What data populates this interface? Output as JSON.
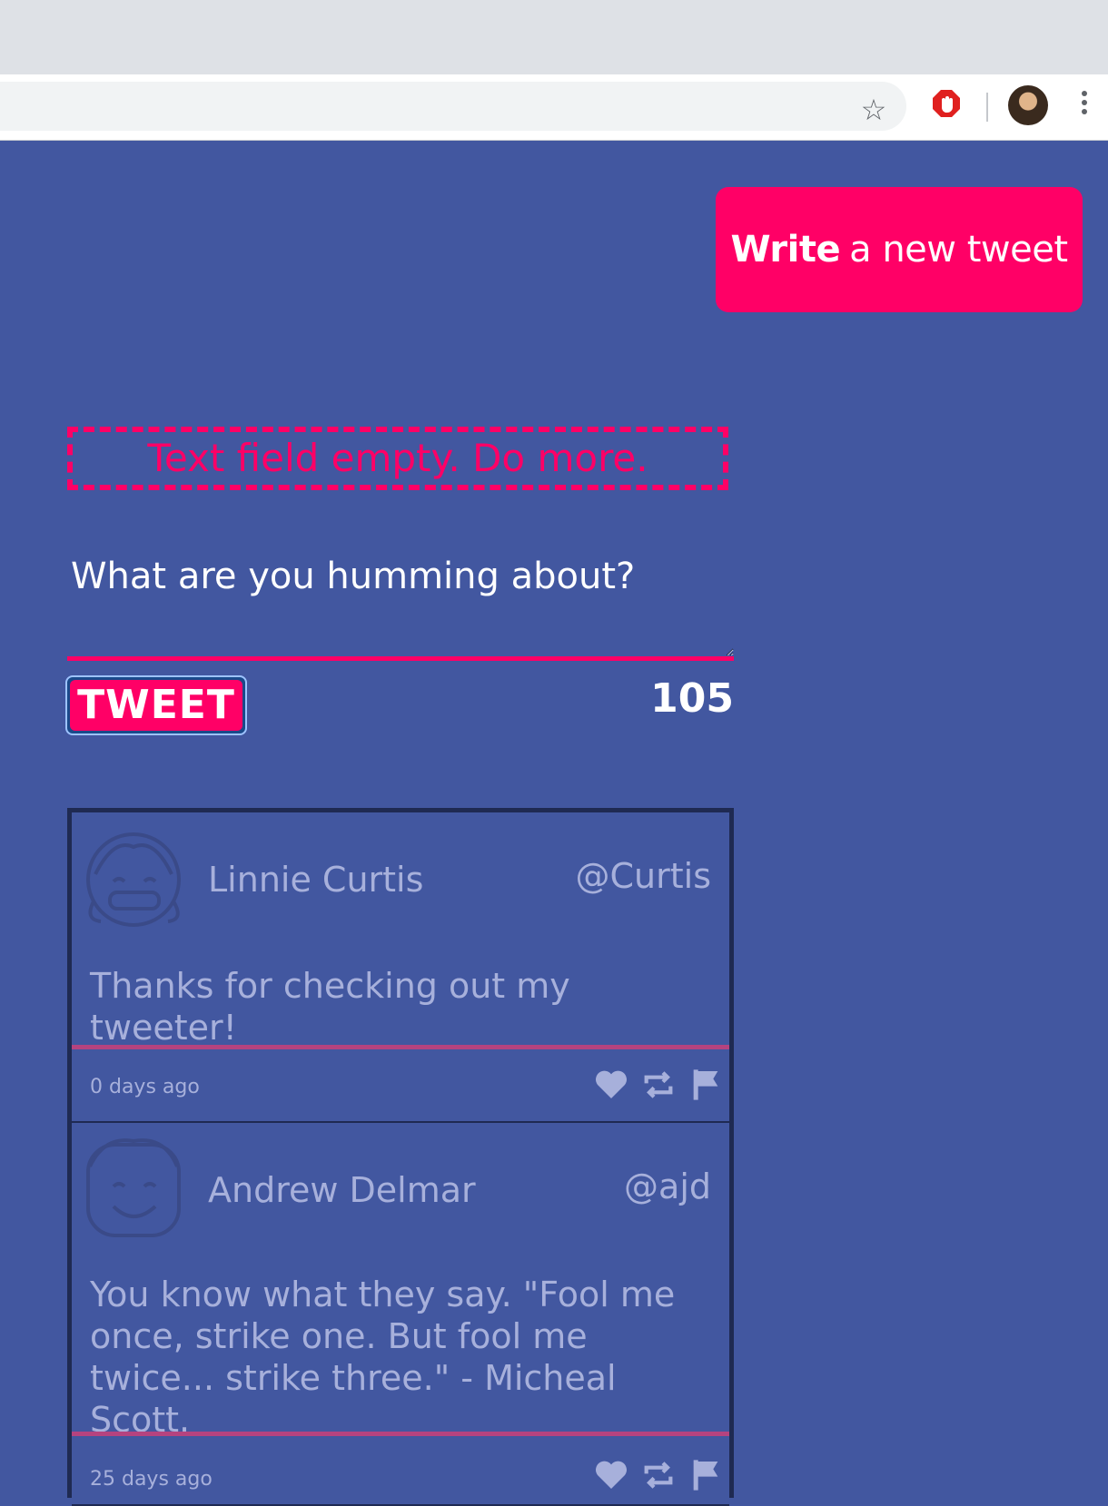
{
  "browser": {
    "icons": [
      "star-icon",
      "adblock-icon",
      "profile-avatar",
      "menu-kebab-icon"
    ]
  },
  "header": {
    "write_bold": "Write",
    "write_rest": "a new tweet"
  },
  "compose": {
    "error": "Text field empty. Do more.",
    "placeholder": "What are you humming about?",
    "submit_label": "TWEET",
    "counter": "105"
  },
  "tweets": [
    {
      "name": "Linnie Curtis",
      "handle": "@Curtis",
      "text": "Thanks for checking out my tweeter!",
      "age": "0 days ago"
    },
    {
      "name": "Andrew Delmar",
      "handle": "@ajd",
      "text": "You know what they say. \"Fool me once, strike one. But fool me twice... strike three.\" - Micheal Scott.",
      "age": "25 days ago"
    }
  ],
  "colors": {
    "background": "#4257a0",
    "accent": "#ff0066",
    "muted_text": "#a7b0db",
    "tweet_border": "#1f2a52"
  }
}
